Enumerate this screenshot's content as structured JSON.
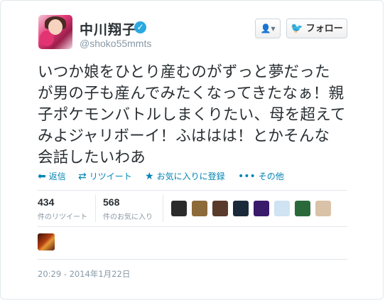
{
  "user": {
    "name": "中川翔子",
    "verified_mark": "✓",
    "handle": "@shoko55mmts"
  },
  "buttons": {
    "user_menu_icon": "user-icon",
    "user_menu_glyph": "👤▾",
    "follow_label": "フォロー",
    "follow_icon": "twitter-bird-icon"
  },
  "tweet": {
    "text": "いつか娘をひとり産むのがずっと夢だった\nが男の子も産んでみたくなってきたなぁ！親\n子ポケモンバトルしまくりたい、母を超えて\nみよジャリボーイ！ふははは！とかそんな\n会話したいわあ"
  },
  "actions": [
    {
      "icon": "reply-icon",
      "glyph": "⬅",
      "label": "返信"
    },
    {
      "icon": "retweet-icon",
      "glyph": "⇄",
      "label": "リツイート"
    },
    {
      "icon": "star-icon",
      "glyph": "★",
      "label": "お気に入りに登録"
    },
    {
      "icon": "more-icon",
      "glyph": "•••",
      "label": "その他"
    }
  ],
  "stats": {
    "retweets": {
      "value": "434",
      "label": "件のリツイート"
    },
    "favorites": {
      "value": "568",
      "label": "件のお気に入り"
    }
  },
  "favoriters": [
    {
      "name": "favoriter-avatar-1",
      "color": "#2b2b2b"
    },
    {
      "name": "favoriter-avatar-2",
      "color": "#8c6a3a"
    },
    {
      "name": "favoriter-avatar-3",
      "color": "#5a3a2a"
    },
    {
      "name": "favoriter-avatar-4",
      "color": "#1a2a3a"
    },
    {
      "name": "favoriter-avatar-5",
      "color": "#3a1a6a"
    },
    {
      "name": "favoriter-avatar-6",
      "color": "#cfe3f2"
    },
    {
      "name": "favoriter-avatar-7",
      "color": "#2a6a3a"
    },
    {
      "name": "favoriter-avatar-8",
      "color": "#d9c2a8"
    }
  ],
  "timestamp": "20:29 - 2014年1月22日",
  "colors": {
    "link": "#0084b4",
    "muted": "#8899a6",
    "text": "#292f33",
    "verified": "#2aa9e0",
    "twitter_blue": "#55acee"
  }
}
